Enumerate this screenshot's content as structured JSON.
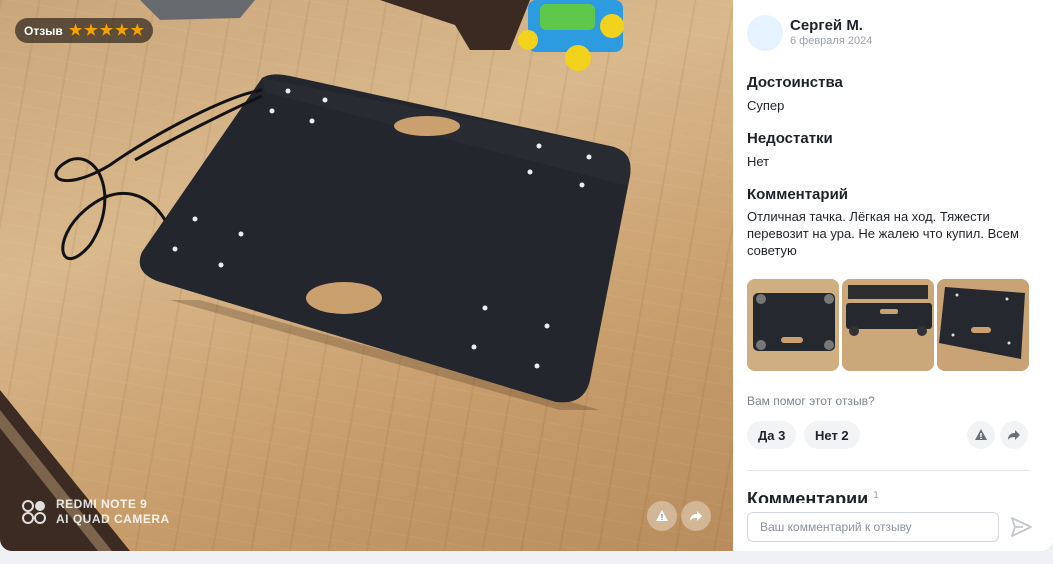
{
  "photo": {
    "badge_label": "Отзыв",
    "rating": 5,
    "watermark_line1": "REDMI NOTE 9",
    "watermark_line2": "AI QUAD CAMERA"
  },
  "review": {
    "author": "Сергей М.",
    "date": "6 февраля 2024",
    "pros_heading": "Достоинства",
    "pros_text": "Супер",
    "cons_heading": "Недостатки",
    "cons_text": "Нет",
    "comment_heading": "Комментарий",
    "comment_text": "Отличная тачка. Лёгкая на ход. Тяжести перевозит на ура. Не жалею что купил. Всем советую",
    "helpful_question": "Вам помог этот отзыв?",
    "yes_label": "Да 3",
    "no_label": "Нет 2"
  },
  "comments": {
    "heading": "Комментарии",
    "count": "1",
    "input_placeholder": "Ваш комментарий к отзыву"
  },
  "icons": {
    "star": "star-icon",
    "report": "warning-icon",
    "share": "share-arrow-icon",
    "send": "send-icon"
  },
  "colors": {
    "star": "#f7a200",
    "panel_bg": "#ffffff",
    "page_bg": "#eef0f3"
  }
}
